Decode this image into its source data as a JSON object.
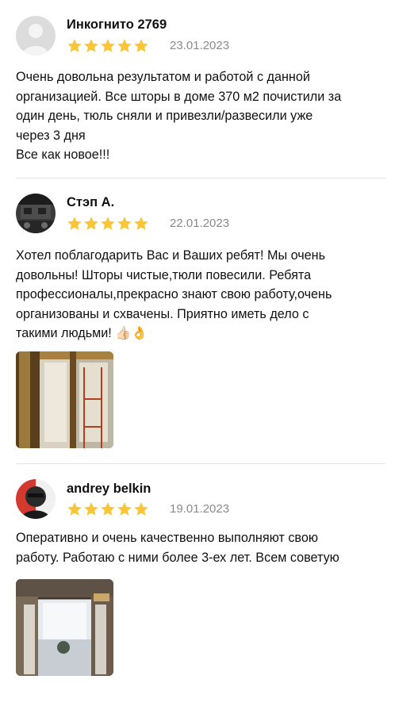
{
  "reviews": [
    {
      "author": "Инкогнито 2769",
      "rating": 5,
      "date": "23.01.2023",
      "text": "Очень довольна результатом и работой с данной\nорганизацией. Все шторы в доме 370 м2 почистили за\nодин день, тюль сняли и привезли/развесили уже\nчерез 3 дня\nВсе как новое!!!"
    },
    {
      "author": "Стэп А.",
      "rating": 5,
      "date": "22.01.2023",
      "text": "Хотел поблагодарить Вас и Ваших ребят! Мы очень\nдовольны! Шторы чистые,тюли повесили. Ребята\nпрофессионалы,прекрасно знают свою работу,очень\nорганизованы и схвачены. Приятно иметь дело с\nтакими людьми! 👍🏻👌"
    },
    {
      "author": "andrey belkin",
      "rating": 5,
      "date": "19.01.2023",
      "text": "Оперативно и очень качественно выполняют свою\nработу. Работаю с ними более 3-ех лет. Всем советую"
    }
  ],
  "colors": {
    "star": "#f8c636",
    "date": "#8a8a8a",
    "divider": "#e4e4e4"
  }
}
